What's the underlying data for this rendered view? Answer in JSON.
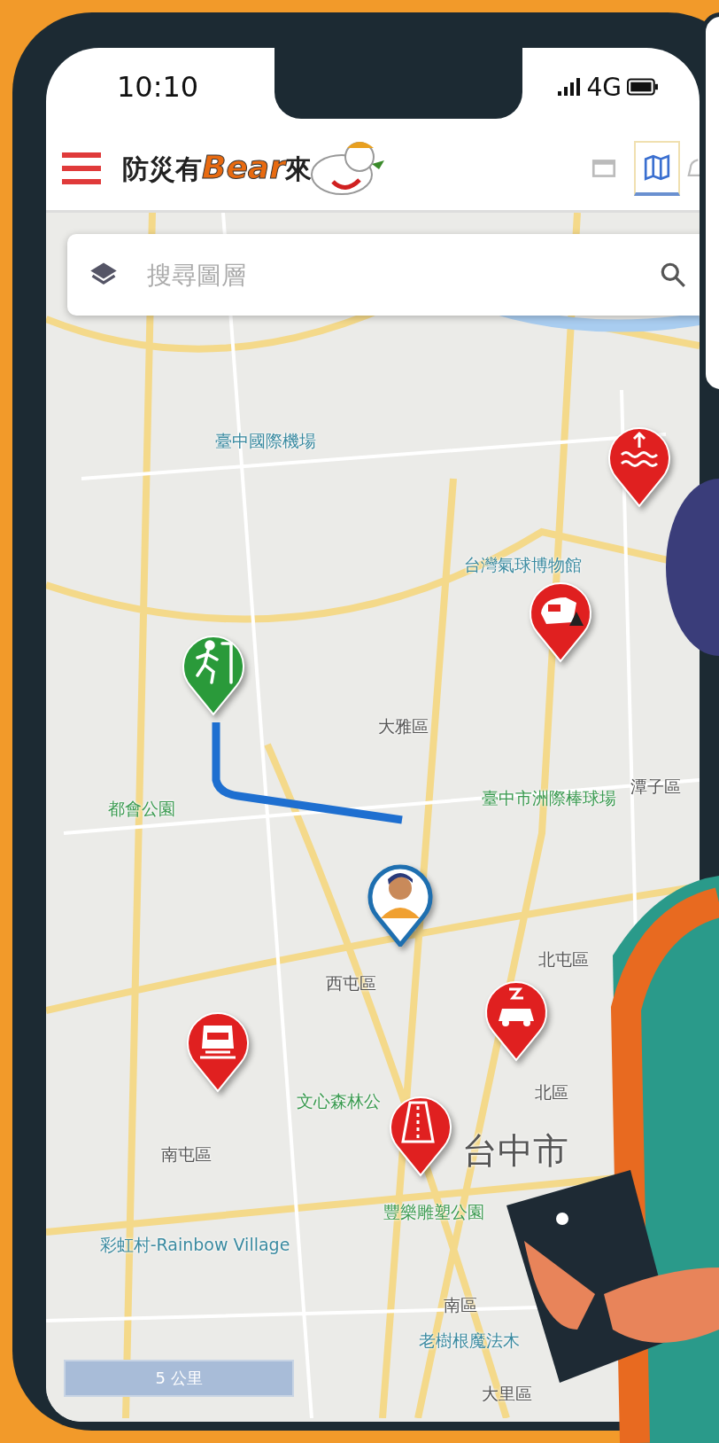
{
  "status_bar": {
    "time": "10:10",
    "network": "4G"
  },
  "header": {
    "logo": {
      "prefix": "防災有",
      "brand": "Bear",
      "suffix": "來"
    },
    "view_toggles": [
      {
        "kind": "list",
        "selected": false
      },
      {
        "kind": "map",
        "selected": true
      }
    ]
  },
  "search": {
    "placeholder": "搜尋圖層"
  },
  "map": {
    "labels": [
      {
        "text": "臺中國際機場",
        "kind": "poi"
      },
      {
        "text": "台灣氣球博物館",
        "kind": "poi"
      },
      {
        "text": "大雅區",
        "kind": "district"
      },
      {
        "text": "潭子區",
        "kind": "district"
      },
      {
        "text": "臺中市洲際棒球場",
        "kind": "park"
      },
      {
        "text": "都會公園",
        "kind": "park"
      },
      {
        "text": "西屯區",
        "kind": "district"
      },
      {
        "text": "北屯區",
        "kind": "district"
      },
      {
        "text": "文心森林公",
        "kind": "park"
      },
      {
        "text": "北區",
        "kind": "district"
      },
      {
        "text": "南屯區",
        "kind": "district"
      },
      {
        "text": "台中市",
        "kind": "city"
      },
      {
        "text": "豐樂雕塑公園",
        "kind": "park"
      },
      {
        "text": "彩虹村-Rainbow Village",
        "kind": "poi"
      },
      {
        "text": "南區",
        "kind": "district"
      },
      {
        "text": "老樹根魔法木",
        "kind": "poi"
      },
      {
        "text": "大里區",
        "kind": "district"
      }
    ],
    "pins": [
      {
        "kind": "flood",
        "color": "#e02020"
      },
      {
        "kind": "rail",
        "color": "#e02020"
      },
      {
        "kind": "evacuation",
        "color": "#2a9a3a"
      },
      {
        "kind": "user",
        "color": "#1e6fb0"
      },
      {
        "kind": "car",
        "color": "#e02020"
      },
      {
        "kind": "train",
        "color": "#e02020"
      },
      {
        "kind": "road",
        "color": "#e02020"
      }
    ],
    "scale": "5 公里"
  }
}
